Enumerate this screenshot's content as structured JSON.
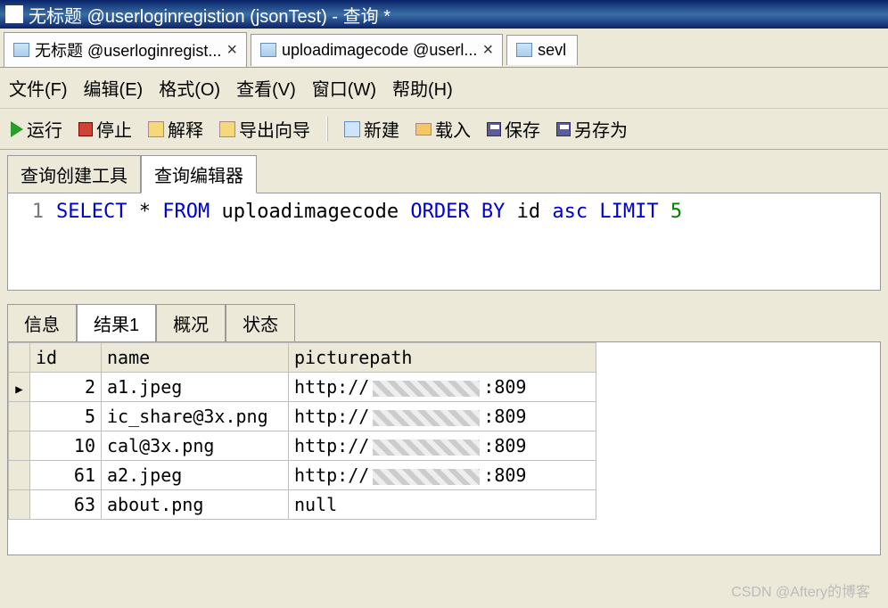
{
  "window": {
    "title": "无标题 @userloginregistion (jsonTest) - 查询 *"
  },
  "doc_tabs": [
    {
      "label": "无标题 @userloginregist..."
    },
    {
      "label": "uploadimagecode @userl..."
    },
    {
      "label": "sevl"
    }
  ],
  "menu": {
    "file": "文件(F)",
    "edit": "编辑(E)",
    "format": "格式(O)",
    "view": "查看(V)",
    "window": "窗口(W)",
    "help": "帮助(H)"
  },
  "toolbar": {
    "run": "运行",
    "stop": "停止",
    "explain": "解释",
    "export": "导出向导",
    "new": "新建",
    "load": "载入",
    "save": "保存",
    "saveas": "另存为"
  },
  "editor_tabs": {
    "builder": "查询创建工具",
    "editor": "查询编辑器"
  },
  "sql": {
    "line": "1",
    "select": "SELECT",
    "star": "*",
    "from": "FROM",
    "table": "uploadimagecode",
    "orderby": "ORDER BY",
    "col": "id",
    "asc": "asc",
    "limit": "LIMIT",
    "n": "5"
  },
  "result_tabs": {
    "info": "信息",
    "result": "结果1",
    "profile": "概况",
    "status": "状态"
  },
  "grid": {
    "columns": [
      "id",
      "name",
      "picturepath"
    ],
    "rows": [
      {
        "id": "2",
        "name": "a1.jpeg",
        "path_prefix": "http://",
        "path_suffix": ":809"
      },
      {
        "id": "5",
        "name": "ic_share@3x.png",
        "path_prefix": "http://",
        "path_suffix": ":809"
      },
      {
        "id": "10",
        "name": "cal@3x.png",
        "path_prefix": "http://",
        "path_suffix": ":809"
      },
      {
        "id": "61",
        "name": "a2.jpeg",
        "path_prefix": "http://",
        "path_suffix": ":809"
      },
      {
        "id": "63",
        "name": "about.png",
        "path_prefix": "null",
        "path_suffix": ""
      }
    ]
  },
  "watermark": "CSDN @Aftery的博客"
}
